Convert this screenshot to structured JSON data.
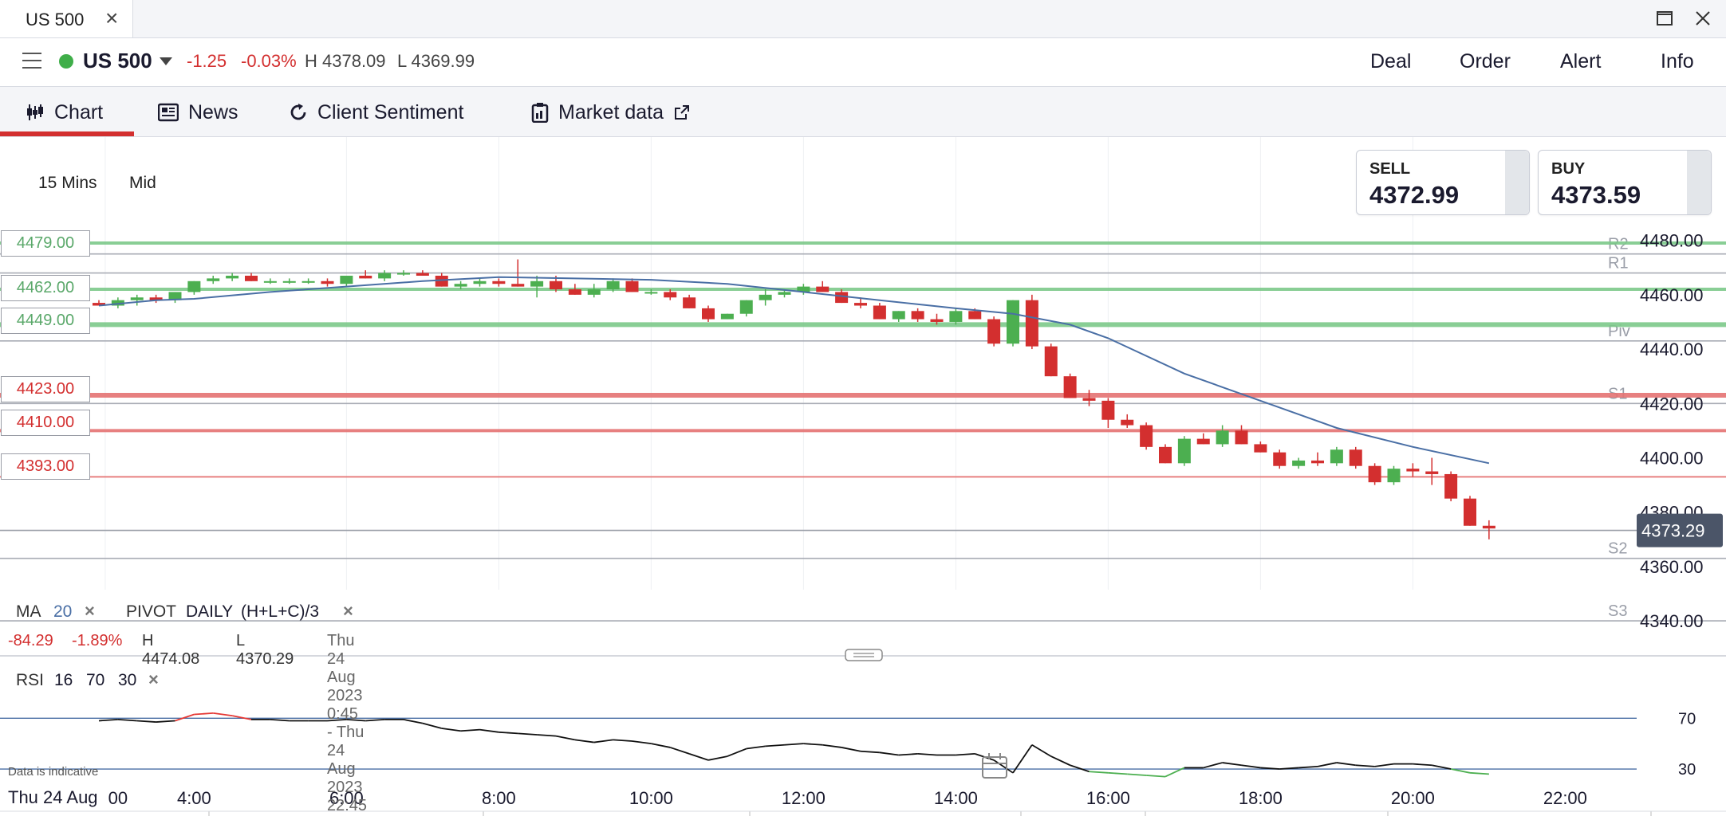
{
  "window": {
    "tab_title": "US 500"
  },
  "header": {
    "instrument": "US 500",
    "change": "-1.25",
    "change_pct": "-0.03%",
    "high": "H 4378.09",
    "low": "L 4369.99",
    "actions": [
      "Deal",
      "Order",
      "Alert",
      "Info"
    ]
  },
  "tabs": [
    {
      "label": "Chart"
    },
    {
      "label": "News"
    },
    {
      "label": "Client Sentiment"
    },
    {
      "label": "Market data"
    }
  ],
  "toolbar": {
    "timeframe": "15 Mins",
    "price_type": "Mid"
  },
  "quote": {
    "sell_label": "SELL",
    "sell": "4372.99",
    "buy_label": "BUY",
    "buy": "4373.59"
  },
  "colors": {
    "up": "#4caf50",
    "down": "#d32f2f",
    "ma": "#4a6fa5",
    "accent": "#d32f2f",
    "status": "#3fae49"
  },
  "levels": {
    "green_orders": [
      "4479.00",
      "4462.00",
      "4449.00"
    ],
    "red_orders": [
      "4423.00",
      "4410.00",
      "4393.00"
    ],
    "pivots": [
      "R2",
      "R1",
      "Piv",
      "S1",
      "S2",
      "S3"
    ]
  },
  "indicators": {
    "ma_label": "MA",
    "ma_period": "20",
    "pivot_label": "PIVOT",
    "pivot_period": "DAILY",
    "pivot_formula": "(H+L+C)/3",
    "rsi_label": "RSI",
    "rsi_period": "16",
    "rsi_upper": "70",
    "rsi_lower": "30"
  },
  "stats": {
    "change": "-84.29",
    "change_pct": "-1.89%",
    "high": "H 4474.08",
    "low": "L 4370.29",
    "range": "Thu 24 Aug 2023 0:45 - Thu 24 Aug 2023 22:45"
  },
  "current_price": "4373.29",
  "footer": {
    "note": "Data is indicative",
    "date": "Thu 24 Aug"
  },
  "chart_data": {
    "type": "candlestick",
    "interval": "15 Mins",
    "y_axis": {
      "range": [
        4333,
        4484
      ],
      "ticks": [
        "4480.00",
        "4460.00",
        "4440.00",
        "4420.00",
        "4400.00",
        "4380.00",
        "4360.00",
        "4340.00"
      ]
    },
    "x_axis": {
      "range": [
        "2:45",
        "22:45"
      ],
      "ticks": [
        "00",
        "4:00",
        "6:00",
        "8:00",
        "10:00",
        "12:00",
        "14:00",
        "16:00",
        "18:00",
        "20:00",
        "22:00"
      ]
    },
    "pivot_levels": {
      "R2": 4475,
      "R1": 4468,
      "Piv": 4443,
      "S1": 4420,
      "S2": 4363,
      "S3": 4340
    },
    "candles": [
      [
        "2:45",
        4457,
        4458,
        4456,
        4456
      ],
      [
        "3:00",
        4456,
        4459,
        4455,
        4458
      ],
      [
        "3:15",
        4458,
        4460,
        4456,
        4459
      ],
      [
        "3:30",
        4459,
        4460,
        4457,
        4458
      ],
      [
        "3:45",
        4458,
        4461,
        4457,
        4461
      ],
      [
        "4:00",
        4461,
        4465,
        4460,
        4465
      ],
      [
        "4:15",
        4465,
        4467,
        4464,
        4466
      ],
      [
        "4:30",
        4466,
        4468,
        4465,
        4467
      ],
      [
        "4:45",
        4467,
        4468,
        4465,
        4465
      ],
      [
        "5:00",
        4465,
        4466,
        4464,
        4465
      ],
      [
        "5:15",
        4465,
        4466,
        4464,
        4465
      ],
      [
        "5:30",
        4465,
        4466,
        4464,
        4465
      ],
      [
        "5:45",
        4465,
        4466,
        4463,
        4464
      ],
      [
        "6:00",
        4464,
        4467,
        4463,
        4467
      ],
      [
        "6:15",
        4467,
        4469,
        4466,
        4466
      ],
      [
        "6:30",
        4466,
        4469,
        4465,
        4468
      ],
      [
        "6:45",
        4468,
        4469,
        4467,
        4468
      ],
      [
        "7:00",
        4468,
        4469,
        4467,
        4467
      ],
      [
        "7:15",
        4467,
        4468,
        4463,
        4463
      ],
      [
        "7:30",
        4463,
        4465,
        4462,
        4464
      ],
      [
        "7:45",
        4464,
        4466,
        4463,
        4465
      ],
      [
        "8:00",
        4465,
        4466,
        4463,
        4464
      ],
      [
        "8:15",
        4464,
        4473,
        4463,
        4463
      ],
      [
        "8:30",
        4463,
        4467,
        4459,
        4465
      ],
      [
        "8:45",
        4465,
        4467,
        4461,
        4462
      ],
      [
        "9:00",
        4462,
        4464,
        4460,
        4460
      ],
      [
        "9:15",
        4460,
        4464,
        4459,
        4462
      ],
      [
        "9:30",
        4462,
        4466,
        4461,
        4465
      ],
      [
        "9:45",
        4465,
        4466,
        4461,
        4461
      ],
      [
        "10:00",
        4461,
        4462,
        4460,
        4461
      ],
      [
        "10:15",
        4461,
        4462,
        4458,
        4459
      ],
      [
        "10:30",
        4459,
        4460,
        4455,
        4455
      ],
      [
        "10:45",
        4455,
        4456,
        4450,
        4451
      ],
      [
        "11:00",
        4451,
        4453,
        4451,
        4453
      ],
      [
        "11:15",
        4453,
        4458,
        4452,
        4458
      ],
      [
        "11:30",
        4458,
        4462,
        4456,
        4460
      ],
      [
        "11:45",
        4460,
        4462,
        4459,
        4461
      ],
      [
        "12:00",
        4461,
        4464,
        4460,
        4463
      ],
      [
        "12:15",
        4463,
        4465,
        4461,
        4461
      ],
      [
        "12:30",
        4461,
        4462,
        4457,
        4457
      ],
      [
        "12:45",
        4457,
        4459,
        4455,
        4456
      ],
      [
        "13:00",
        4456,
        4457,
        4451,
        4451
      ],
      [
        "13:15",
        4451,
        4454,
        4450,
        4454
      ],
      [
        "13:30",
        4454,
        4455,
        4450,
        4451
      ],
      [
        "13:45",
        4451,
        4453,
        4449,
        4450
      ],
      [
        "14:00",
        4450,
        4455,
        4449,
        4454
      ],
      [
        "14:15",
        4454,
        4455,
        4451,
        4451
      ],
      [
        "14:30",
        4451,
        4452,
        4441,
        4442
      ],
      [
        "14:45",
        4442,
        4458,
        4441,
        4458
      ],
      [
        "15:00",
        4458,
        4460,
        4440,
        4441
      ],
      [
        "15:15",
        4441,
        4442,
        4430,
        4430
      ],
      [
        "15:30",
        4430,
        4431,
        4422,
        4422
      ],
      [
        "15:45",
        4422,
        4425,
        4419,
        4421
      ],
      [
        "16:00",
        4421,
        4422,
        4411,
        4414
      ],
      [
        "16:15",
        4414,
        4416,
        4411,
        4412
      ],
      [
        "16:30",
        4412,
        4413,
        4403,
        4404
      ],
      [
        "16:45",
        4404,
        4405,
        4398,
        4398
      ],
      [
        "17:00",
        4398,
        4408,
        4397,
        4407
      ],
      [
        "17:15",
        4407,
        4409,
        4405,
        4405
      ],
      [
        "17:30",
        4405,
        4412,
        4404,
        4410
      ],
      [
        "17:45",
        4410,
        4412,
        4405,
        4405
      ],
      [
        "18:00",
        4405,
        4406,
        4402,
        4402
      ],
      [
        "18:15",
        4402,
        4403,
        4396,
        4397
      ],
      [
        "18:30",
        4397,
        4400,
        4396,
        4399
      ],
      [
        "18:45",
        4399,
        4402,
        4397,
        4398
      ],
      [
        "19:00",
        4398,
        4404,
        4397,
        4403
      ],
      [
        "19:15",
        4403,
        4404,
        4396,
        4397
      ],
      [
        "19:30",
        4397,
        4398,
        4390,
        4391
      ],
      [
        "19:45",
        4391,
        4397,
        4390,
        4396
      ],
      [
        "20:00",
        4396,
        4398,
        4393,
        4395
      ],
      [
        "20:15",
        4395,
        4400,
        4390,
        4394
      ],
      [
        "20:30",
        4394,
        4395,
        4384,
        4385
      ],
      [
        "20:45",
        4385,
        4386,
        4375,
        4375
      ],
      [
        "21:00",
        4375,
        4377,
        4370,
        4374
      ]
    ],
    "ma20": [
      [
        "2:45",
        4456
      ],
      [
        "3:30",
        4458
      ],
      [
        "4:00",
        4458.5
      ],
      [
        "5:00",
        4461
      ],
      [
        "6:00",
        4463
      ],
      [
        "7:00",
        4465
      ],
      [
        "8:00",
        4466.5
      ],
      [
        "9:00",
        4466
      ],
      [
        "10:00",
        4465.5
      ],
      [
        "11:00",
        4464
      ],
      [
        "12:00",
        4461
      ],
      [
        "13:00",
        4458
      ],
      [
        "14:00",
        4455
      ],
      [
        "14:45",
        4453
      ],
      [
        "15:30",
        4449
      ],
      [
        "16:00",
        4444
      ],
      [
        "17:00",
        4431
      ],
      [
        "18:00",
        4421
      ],
      [
        "19:00",
        4411
      ],
      [
        "20:00",
        4404
      ],
      [
        "21:00",
        4398
      ]
    ],
    "rsi": {
      "range": [
        -7,
        121
      ],
      "upper": 70,
      "lower": 30,
      "values": [
        [
          "2:45",
          68
        ],
        [
          "3:00",
          69
        ],
        [
          "3:15",
          68
        ],
        [
          "3:30",
          67
        ],
        [
          "3:45",
          68
        ],
        [
          "4:00",
          73
        ],
        [
          "4:15",
          74
        ],
        [
          "4:30",
          72
        ],
        [
          "4:45",
          69
        ],
        [
          "5:00",
          69
        ],
        [
          "5:15",
          68
        ],
        [
          "5:30",
          68
        ],
        [
          "5:45",
          68
        ],
        [
          "6:00",
          69
        ],
        [
          "6:15",
          68
        ],
        [
          "6:30",
          69
        ],
        [
          "6:45",
          69
        ],
        [
          "7:00",
          66
        ],
        [
          "7:15",
          62
        ],
        [
          "7:30",
          60
        ],
        [
          "7:45",
          61
        ],
        [
          "8:00",
          59
        ],
        [
          "8:15",
          58
        ],
        [
          "8:30",
          57
        ],
        [
          "8:45",
          56
        ],
        [
          "9:00",
          53
        ],
        [
          "9:15",
          51
        ],
        [
          "9:30",
          53
        ],
        [
          "9:45",
          52
        ],
        [
          "10:00",
          50
        ],
        [
          "10:15",
          47
        ],
        [
          "10:30",
          42
        ],
        [
          "10:45",
          37
        ],
        [
          "11:00",
          40
        ],
        [
          "11:15",
          46
        ],
        [
          "11:30",
          48
        ],
        [
          "11:45",
          49
        ],
        [
          "12:00",
          50
        ],
        [
          "12:15",
          49
        ],
        [
          "12:30",
          47
        ],
        [
          "12:45",
          44
        ],
        [
          "13:00",
          43
        ],
        [
          "13:15",
          41
        ],
        [
          "13:30",
          42
        ],
        [
          "13:45",
          41
        ],
        [
          "14:00",
          41
        ],
        [
          "14:15",
          42
        ],
        [
          "14:30",
          37
        ],
        [
          "14:45",
          27
        ],
        [
          "15:00",
          49
        ],
        [
          "15:15",
          40
        ],
        [
          "15:30",
          33
        ],
        [
          "15:45",
          28
        ],
        [
          "16:00",
          27
        ],
        [
          "16:15",
          26
        ],
        [
          "16:30",
          25
        ],
        [
          "16:45",
          24
        ],
        [
          "17:00",
          31
        ],
        [
          "17:15",
          31
        ],
        [
          "17:30",
          35
        ],
        [
          "17:45",
          33
        ],
        [
          "18:00",
          31
        ],
        [
          "18:15",
          30
        ],
        [
          "18:30",
          31
        ],
        [
          "18:45",
          32
        ],
        [
          "19:00",
          35
        ],
        [
          "19:15",
          33
        ],
        [
          "19:30",
          32
        ],
        [
          "19:45",
          34
        ],
        [
          "20:00",
          34
        ],
        [
          "20:15",
          33
        ],
        [
          "20:30",
          30
        ],
        [
          "20:45",
          27
        ],
        [
          "21:00",
          26
        ]
      ]
    },
    "indicator_lines": [
      "MA 20",
      "PIVOT DAILY (H+L+C)/3",
      "RSI 16 70 30"
    ],
    "last_price": 4373.29
  }
}
